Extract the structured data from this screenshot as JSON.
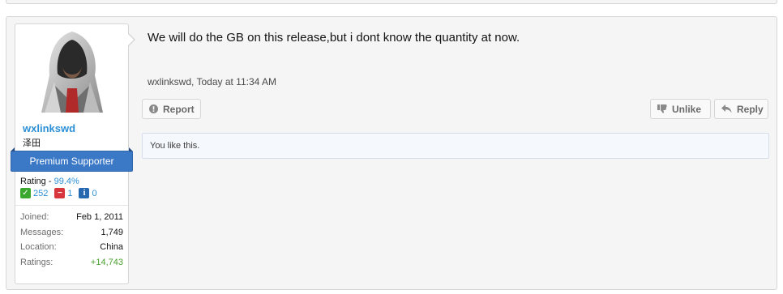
{
  "user": {
    "username": "wxlinkswd",
    "custom_title": "泽田",
    "banner": "Premium Supporter",
    "rating_label": "Rating - ",
    "rating_percent": "99.4%",
    "positive": "252",
    "negative": "1",
    "neutral": "0",
    "stats": [
      {
        "key": "Joined:",
        "value": "Feb 1, 2011"
      },
      {
        "key": "Messages:",
        "value": "1,749"
      },
      {
        "key": "Location:",
        "value": "China"
      },
      {
        "key": "Ratings:",
        "value": "+14,743"
      }
    ]
  },
  "post": {
    "message": "We will do the GB on this release,but i dont know the quantity at now.",
    "author": "wxlinkswd",
    "meta_sep": ", ",
    "timestamp": "Today at 11:34 AM",
    "likes_text": "You like this."
  },
  "actions": {
    "report": "Report",
    "unlike": "Unlike",
    "reply": "Reply"
  },
  "icons": {
    "report": "alert-circle-icon",
    "unlike": "thumbs-down-icon",
    "reply": "reply-arrow-icon",
    "positive": "check-icon",
    "negative": "minus-icon",
    "neutral": "info-icon"
  },
  "colors": {
    "link": "#2b8fd6",
    "banner": "#3b79c7",
    "positive": "#3aa82e",
    "negative": "#d7373c",
    "neutral": "#2568b0",
    "ratings_total": "#4aa02c"
  }
}
